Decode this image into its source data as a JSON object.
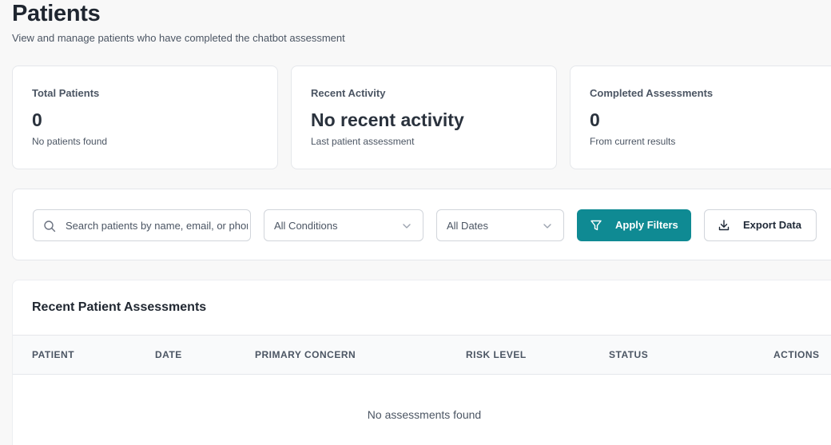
{
  "header": {
    "title": "Patients",
    "subtitle": "View and manage patients who have completed the chatbot assessment"
  },
  "stats": [
    {
      "label": "Total Patients",
      "value": "0",
      "description": "No patients found"
    },
    {
      "label": "Recent Activity",
      "value": "No recent activity",
      "description": "Last patient assessment"
    },
    {
      "label": "Completed Assessments",
      "value": "0",
      "description": "From current results"
    }
  ],
  "filters": {
    "search_placeholder": "Search patients by name, email, or phone",
    "search_value": "",
    "search_icon": "search-icon",
    "condition_select": "All Conditions",
    "date_select": "All Dates",
    "apply_label": "Apply Filters",
    "apply_icon": "filter-icon",
    "export_label": "Export Data",
    "export_icon": "download-icon",
    "accent_color": "#0f8a93"
  },
  "table": {
    "title": "Recent Patient Assessments",
    "columns": [
      "PATIENT",
      "DATE",
      "PRIMARY CONCERN",
      "RISK LEVEL",
      "STATUS",
      "ACTIONS"
    ],
    "rows": [],
    "empty_message": "No assessments found"
  }
}
